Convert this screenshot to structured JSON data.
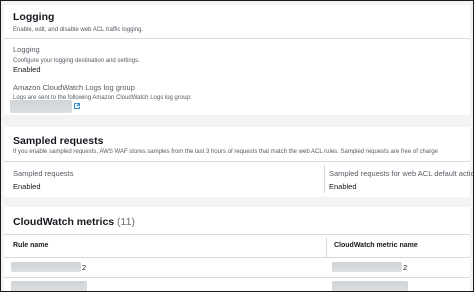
{
  "logging": {
    "title": "Logging",
    "description": "Enable, edit, and disable web ACL traffic logging.",
    "field_label": "Logging",
    "field_help": "Configure your logging destination and settings.",
    "status": "Enabled",
    "group_label": "Amazon CloudWatch Logs log group",
    "group_help": "Logs are sent to the following Amazon CloudWatch Logs log group:",
    "link_icon": "external-link-icon"
  },
  "sampled": {
    "title": "Sampled requests",
    "description": "If you enable sampled requests, AWS WAF stores samples from the last 3 hours of requests that match the web ACL rules. Sampled requests are free of charge",
    "col1_label": "Sampled requests",
    "col1_value": "Enabled",
    "col2_label": "Sampled requests for web ACL default actio",
    "col2_value": "Enabled"
  },
  "metrics": {
    "title": "CloudWatch metrics",
    "count": "(11)",
    "col_rule": "Rule name",
    "col_metric": "CloudWatch metric name",
    "row1_rule_suffix": "2",
    "row1_metric_suffix": "2"
  }
}
